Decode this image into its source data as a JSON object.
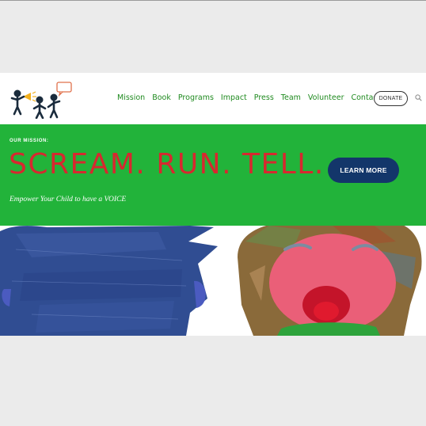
{
  "nav": {
    "items": [
      "Mission",
      "Book",
      "Programs",
      "Impact",
      "Press",
      "Team",
      "Volunteer",
      "Contact"
    ],
    "donate_label": "DONATE"
  },
  "hero": {
    "eyebrow": "OUR MISSION:",
    "headline": "SCREAM. RUN. TELL.",
    "cta_label": "LEARN MORE",
    "tagline": "Empower Your Child to have a VOICE"
  },
  "colors": {
    "nav_text": "#1f8a1f",
    "hero_bg": "#22b33a",
    "headline": "#d7282f",
    "cta_bg": "#13366a"
  },
  "icons": [
    "logo-figures-icon",
    "megaphone-icon",
    "speech-bubble-icon",
    "search-icon"
  ]
}
